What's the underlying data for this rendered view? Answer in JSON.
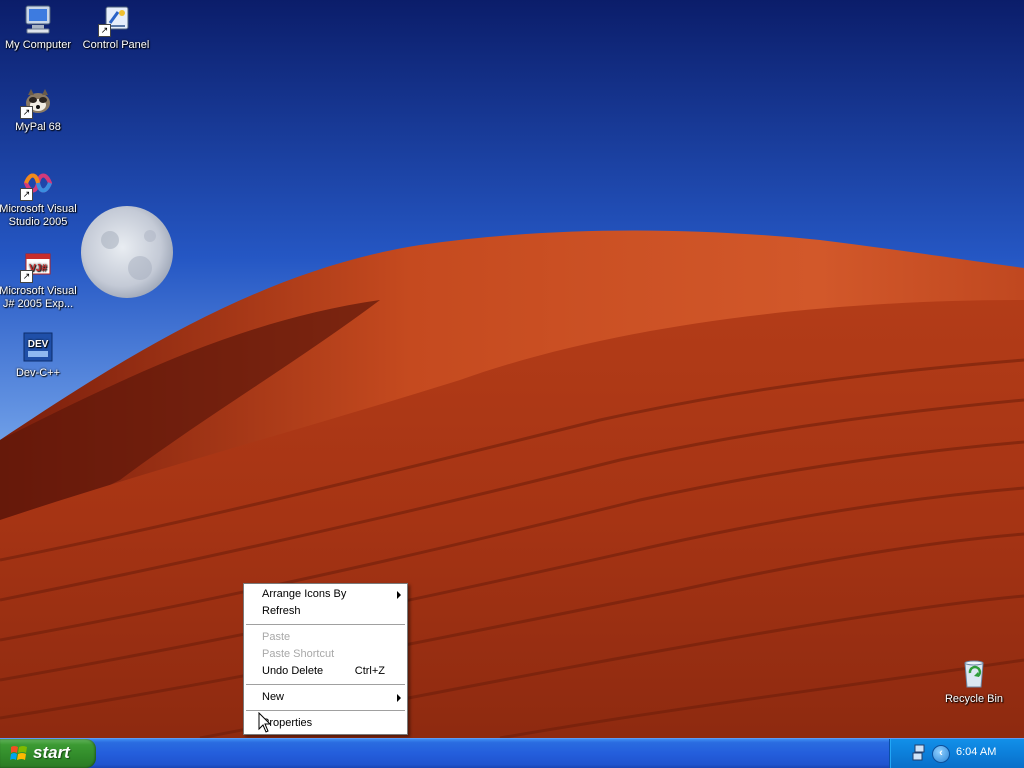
{
  "desktop": {
    "icons": [
      {
        "label": "My Computer",
        "icon": "my-computer-icon"
      },
      {
        "label": "Control Panel",
        "icon": "control-panel-icon"
      },
      {
        "label": "MyPal 68",
        "icon": "mypal-icon"
      },
      {
        "label": "Microsoft Visual Studio 2005",
        "icon": "visual-studio-icon"
      },
      {
        "label": "Microsoft Visual J# 2005 Exp...",
        "icon": "visual-j-sharp-icon"
      },
      {
        "label": "Dev-C++",
        "icon": "dev-cpp-icon"
      },
      {
        "label": "Recycle Bin",
        "icon": "recycle-bin-icon"
      }
    ],
    "dev_icon_text": "DEV",
    "vj_icon_text": "VJ#",
    "wallpaper": "desert-dunes-with-moon"
  },
  "context_menu": {
    "items": [
      {
        "label": "Arrange Icons By",
        "submenu": true,
        "enabled": true
      },
      {
        "label": "Refresh",
        "enabled": true
      },
      {
        "label": "Paste",
        "enabled": false
      },
      {
        "label": "Paste Shortcut",
        "enabled": false
      },
      {
        "label": "Undo Delete",
        "shortcut": "Ctrl+Z",
        "enabled": true
      },
      {
        "label": "New",
        "submenu": true,
        "enabled": true
      },
      {
        "label": "Properties",
        "enabled": true
      }
    ]
  },
  "taskbar": {
    "start_label": "start",
    "tray": {
      "help_glyph": "?",
      "chevron_glyph": "‹",
      "clock": "6:04 AM"
    }
  },
  "colors": {
    "taskbar_blue": "#245edc",
    "start_green": "#3c9a33",
    "tray_blue": "#0c7fda",
    "sand": "#b8391a",
    "sky": "#1b46b0"
  }
}
